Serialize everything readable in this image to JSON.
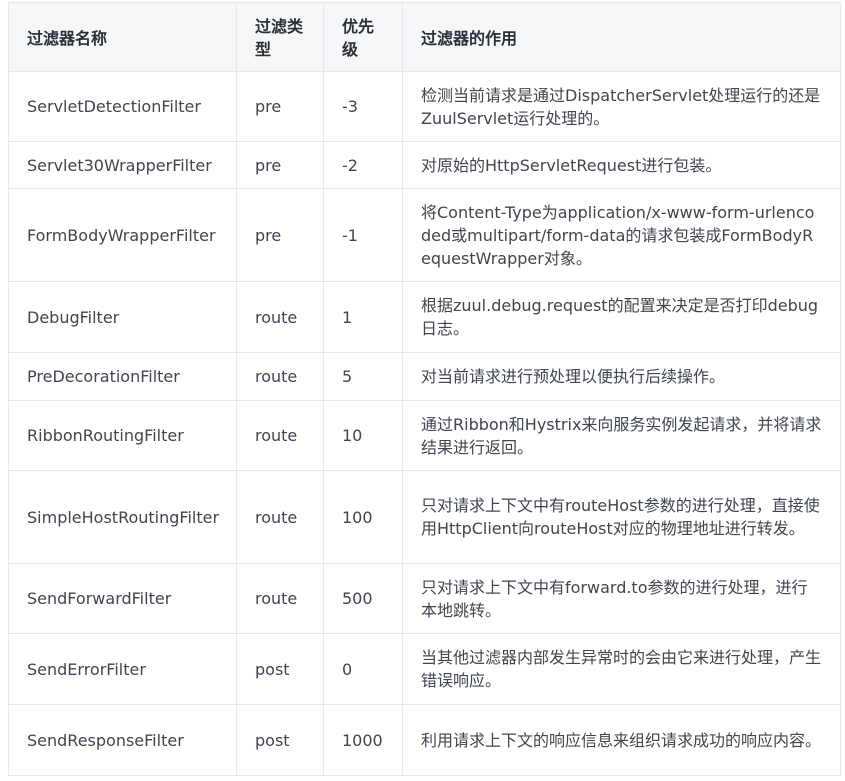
{
  "table": {
    "headers": [
      "过滤器名称",
      "过滤类型",
      "优先级",
      "过滤器的作用"
    ],
    "rows": [
      {
        "name": "ServletDetectionFilter",
        "type": "pre",
        "order": "-3",
        "desc": "检测当前请求是通过DispatcherServlet处理运行的还是ZuulServlet运行处理的。"
      },
      {
        "name": "Servlet30WrapperFilter",
        "type": "pre",
        "order": "-2",
        "desc": "对原始的HttpServletRequest进行包装。"
      },
      {
        "name": "FormBodyWrapperFilter",
        "type": "pre",
        "order": "-1",
        "desc": "将Content-Type为application/x-www-form-urlencoded或multipart/form-data的请求包装成FormBodyRequestWrapper对象。"
      },
      {
        "name": "DebugFilter",
        "type": "route",
        "order": "1",
        "desc": "根据zuul.debug.request的配置来决定是否打印debug日志。"
      },
      {
        "name": "PreDecorationFilter",
        "type": "route",
        "order": "5",
        "desc": "对当前请求进行预处理以便执行后续操作。"
      },
      {
        "name": "RibbonRoutingFilter",
        "type": "route",
        "order": "10",
        "desc": "通过Ribbon和Hystrix来向服务实例发起请求，并将请求结果进行返回。"
      },
      {
        "name": "SimpleHostRoutingFilter",
        "type": "route",
        "order": "100",
        "desc": "只对请求上下文中有routeHost参数的进行处理，直接使用HttpClient向routeHost对应的物理地址进行转发。"
      },
      {
        "name": "SendForwardFilter",
        "type": "route",
        "order": "500",
        "desc": "只对请求上下文中有forward.to参数的进行处理，进行本地跳转。"
      },
      {
        "name": "SendErrorFilter",
        "type": "post",
        "order": "0",
        "desc": "当其他过滤器内部发生异常时的会由它来进行处理，产生错误响应。"
      },
      {
        "name": "SendResponseFilter",
        "type": "post",
        "order": "1000",
        "desc": "利用请求上下文的响应信息来组织请求成功的响应内容。"
      }
    ]
  }
}
